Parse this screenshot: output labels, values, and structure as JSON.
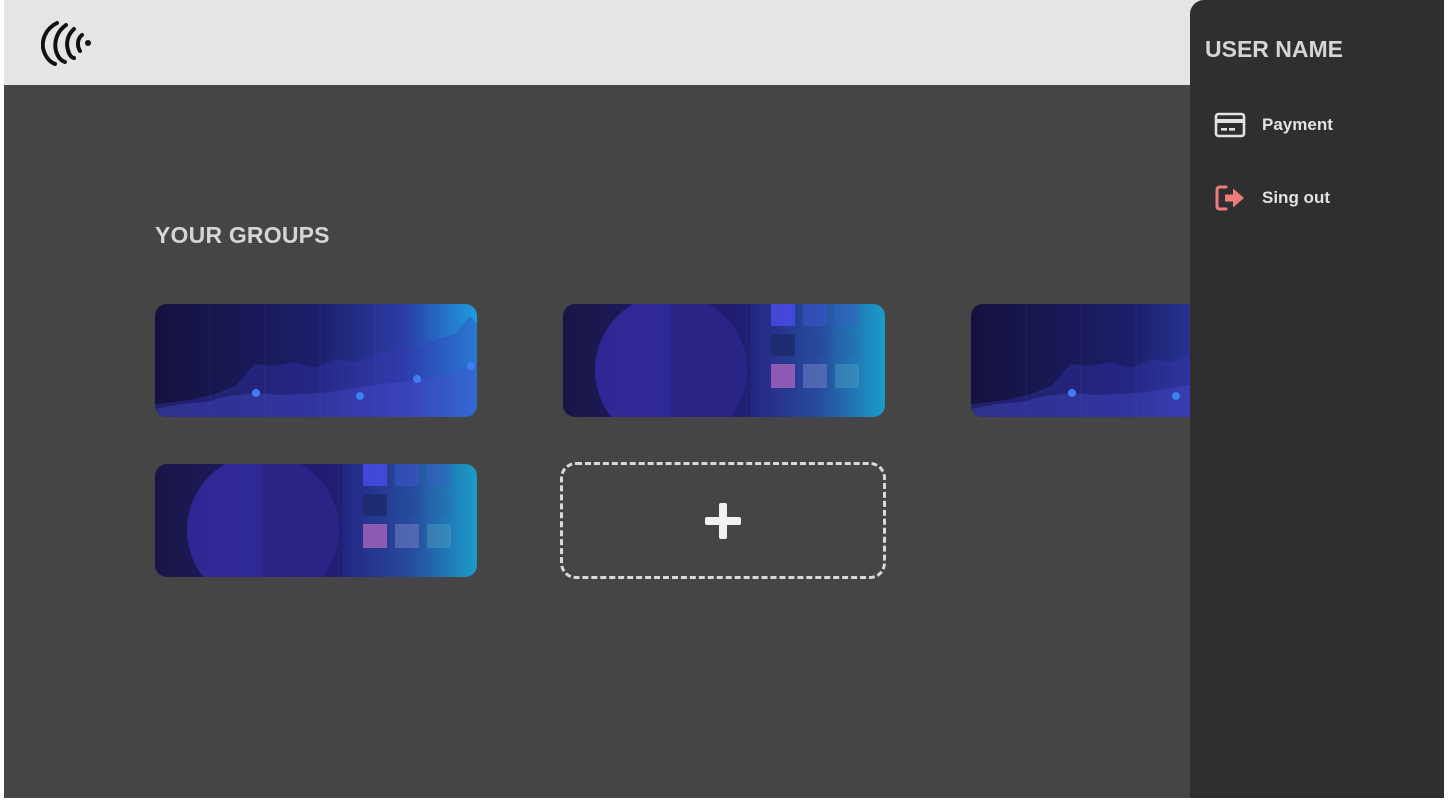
{
  "header": {
    "logo_icon": "concentric-arcs-logo"
  },
  "main": {
    "section_title": "YOUR GROUPS",
    "groups": [
      {
        "thumbnail": "line-chart-thumbnail"
      },
      {
        "thumbnail": "pie-grid-thumbnail"
      },
      {
        "thumbnail": "line-chart-thumbnail"
      },
      {
        "thumbnail": "pie-grid-thumbnail"
      }
    ],
    "add_group_icon": "plus-icon"
  },
  "user_panel": {
    "user_name": "USER NAME",
    "menu": [
      {
        "label": "Payment",
        "icon": "credit-card-icon"
      },
      {
        "label": "Sing out",
        "icon": "sign-out-icon",
        "icon_color": "#f07a7a"
      }
    ]
  },
  "colors": {
    "background": "#454545",
    "topbar": "#e5e5e5",
    "panel": "#2f2f2f",
    "card_gradient_start": "#14123f",
    "card_gradient_end": "#1f9be0"
  }
}
